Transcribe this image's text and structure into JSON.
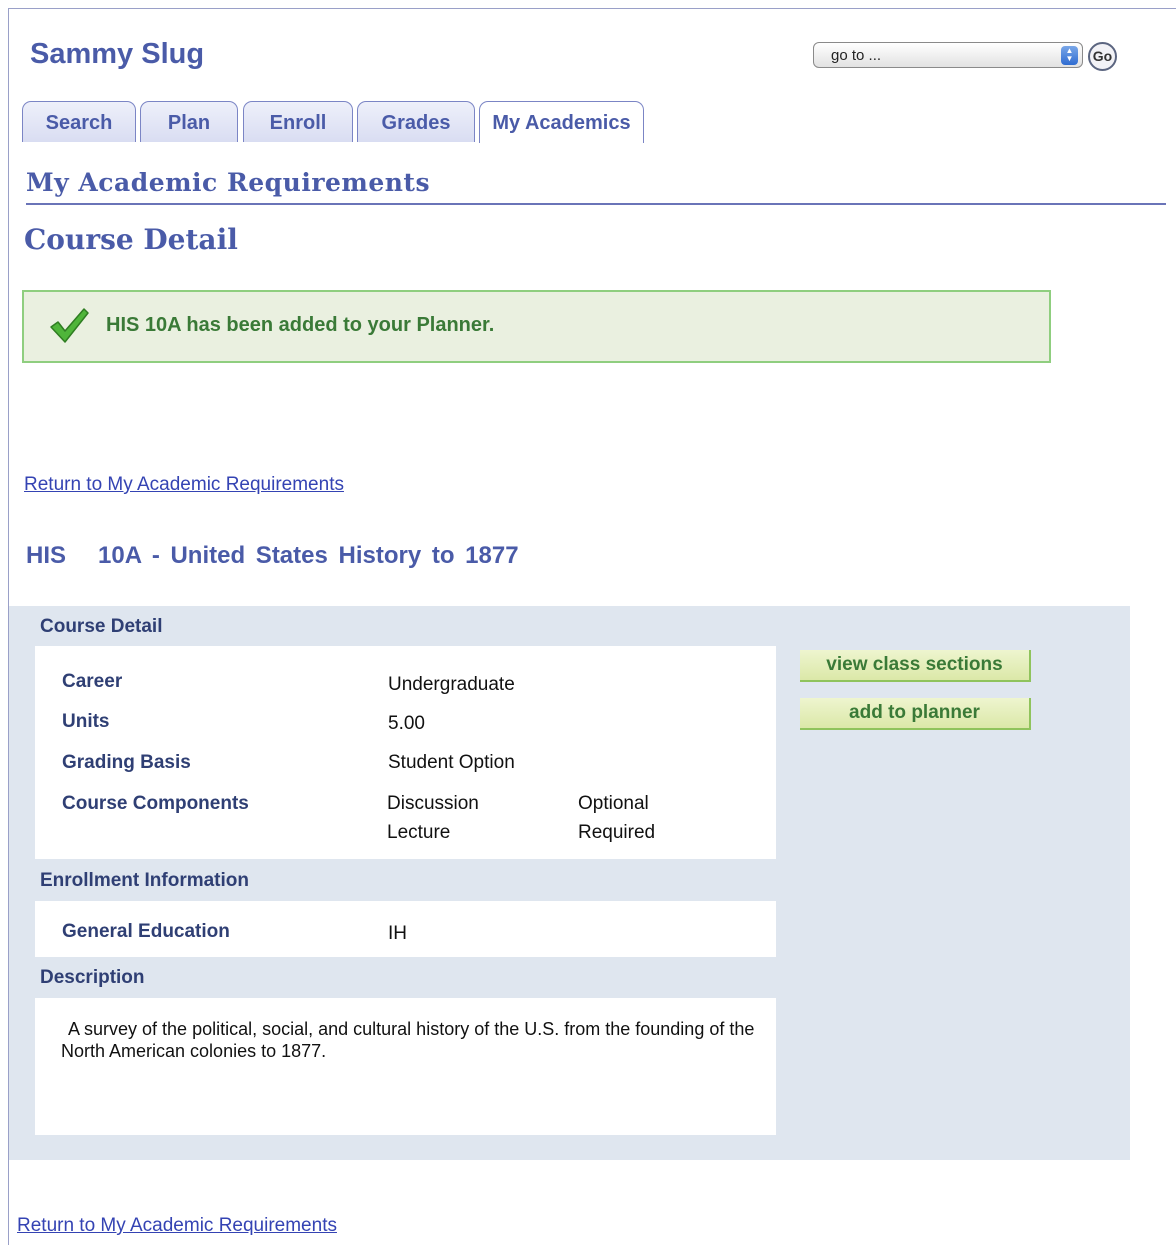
{
  "header": {
    "user_name": "Sammy Slug",
    "goto_placeholder": "go to ...",
    "go_label": "Go"
  },
  "tabs": [
    {
      "label": "Search",
      "active": false
    },
    {
      "label": "Plan",
      "active": false
    },
    {
      "label": "Enroll",
      "active": false
    },
    {
      "label": "Grades",
      "active": false
    },
    {
      "label": "My Academics",
      "active": true
    }
  ],
  "section_title": "My Academic Requirements",
  "page_title": "Course Detail",
  "confirmation": {
    "message": "HIS 10A has been added to your Planner.",
    "icon": "checkmark-icon",
    "color": "#3a7a37"
  },
  "return_link": "Return to My Academic Requirements",
  "course_heading": "HIS   10A - United States History to 1877",
  "course_detail": {
    "heading": "Course Detail",
    "career_label": "Career",
    "career_value": "Undergraduate",
    "units_label": "Units",
    "units_value": "5.00",
    "grading_label": "Grading Basis",
    "grading_value": "Student Option",
    "components_label": "Course Components",
    "components": [
      {
        "name": "Discussion",
        "status": "Optional"
      },
      {
        "name": "Lecture",
        "status": "Required"
      }
    ]
  },
  "enrollment": {
    "heading": "Enrollment Information",
    "ge_label": "General Education",
    "ge_value": "IH"
  },
  "description": {
    "heading": "Description",
    "text": "A survey of the political, social, and cultural history of the U.S. from the founding of the North American colonies to 1877."
  },
  "buttons": {
    "view_sections": "view class sections",
    "add_planner": "add to planner"
  },
  "colors": {
    "brand": "#4a5ba8",
    "panel_bg": "#dfe6ef",
    "success_bg": "#eaf0e0",
    "success_border": "#8fce7f"
  }
}
